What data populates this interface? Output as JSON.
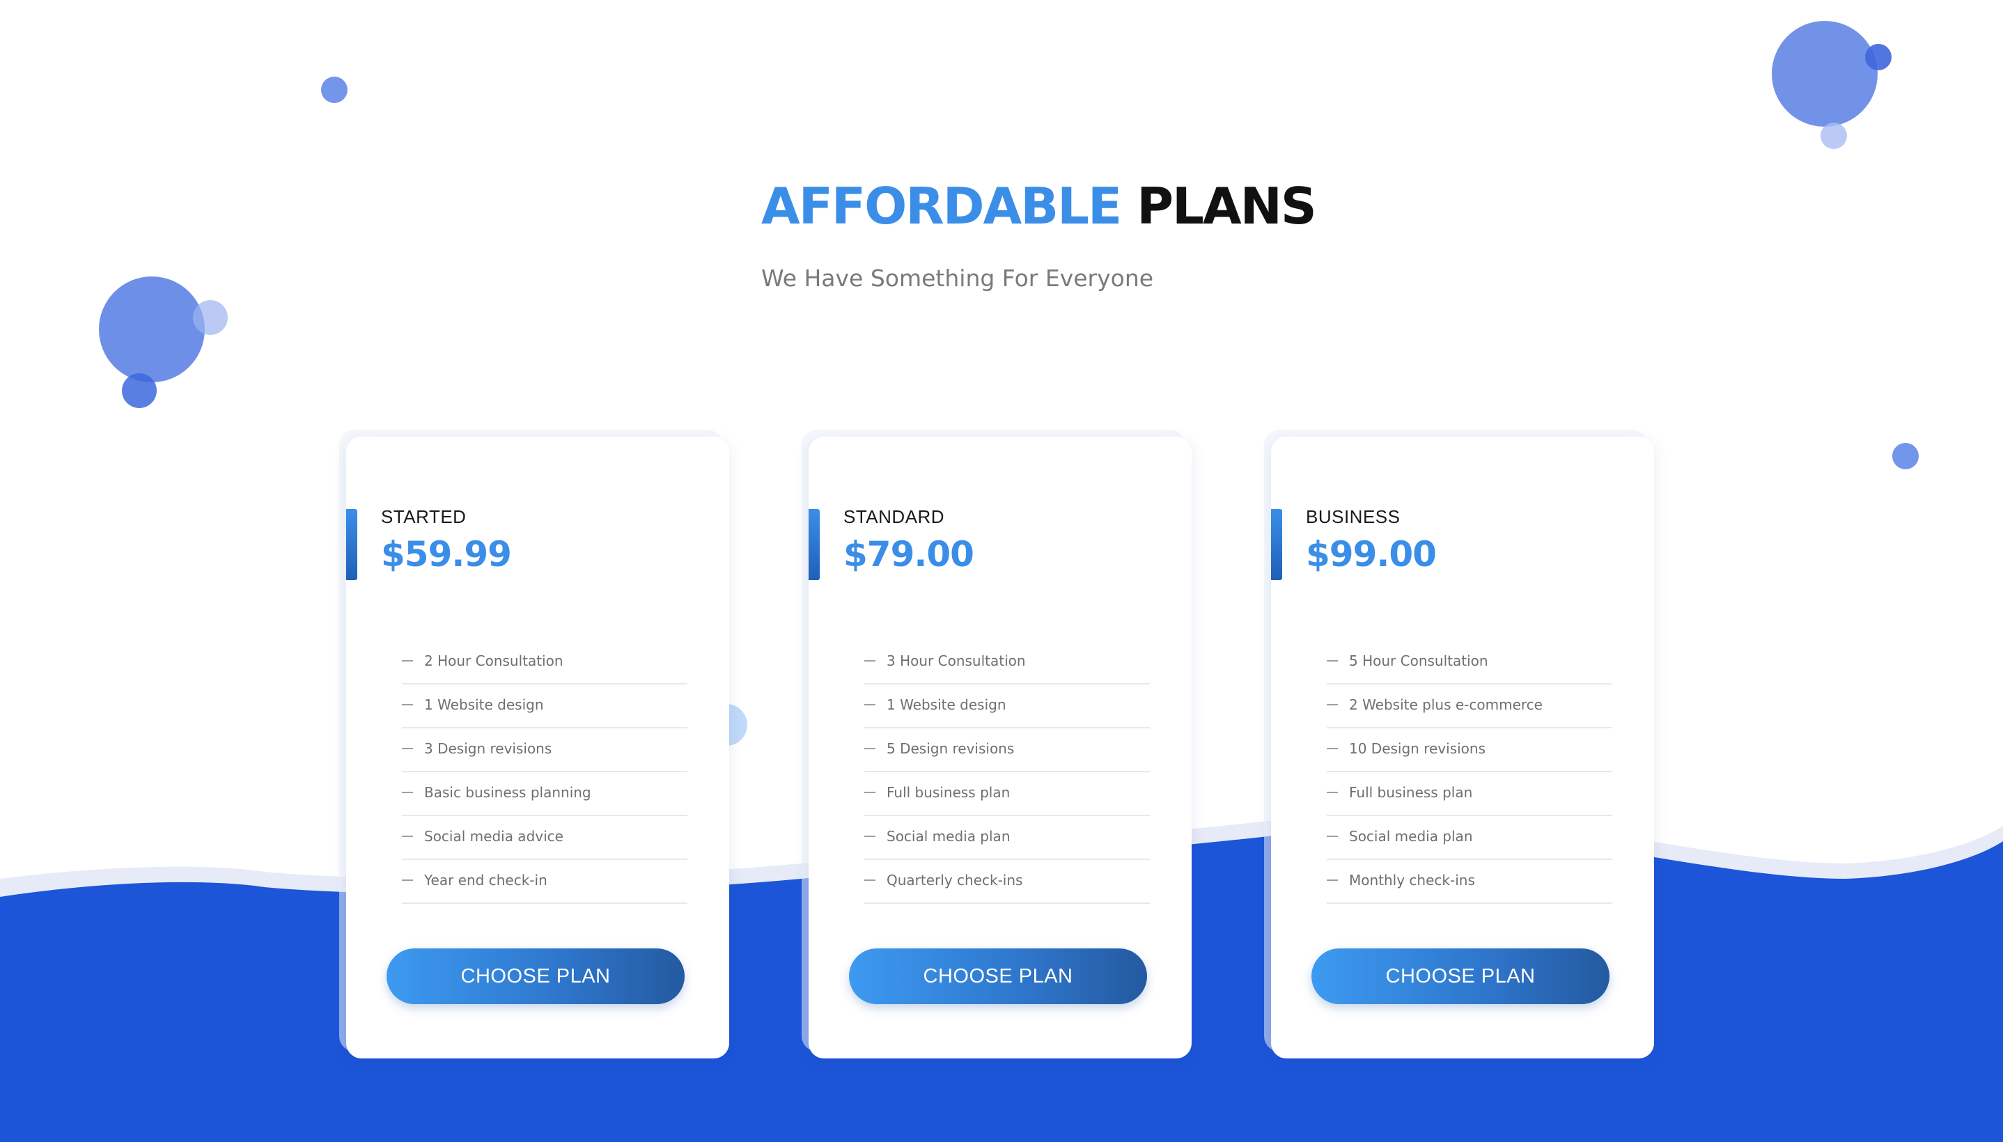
{
  "header": {
    "title_accent": "AFFORDABLE",
    "title_rest": "PLANS",
    "subtitle": "We Have Something For Everyone"
  },
  "colors": {
    "accent": "#3b8ee8",
    "wave_blue": "#1d55d9",
    "button_start": "#3d9af0",
    "button_end": "#245aa0"
  },
  "plans": [
    {
      "name": "STARTED",
      "price": "$59.99",
      "features": [
        "2 Hour Consultation",
        "1 Website design",
        "3 Design revisions",
        "Basic business planning",
        "Social media advice",
        "Year end check-in"
      ],
      "button_label": "CHOOSE PLAN"
    },
    {
      "name": "STANDARD",
      "price": "$79.00",
      "features": [
        "3 Hour Consultation",
        "1 Website design",
        "5 Design revisions",
        "Full business plan",
        "Social media plan",
        "Quarterly check-ins"
      ],
      "button_label": "CHOOSE PLAN"
    },
    {
      "name": "BUSINESS",
      "price": "$99.00",
      "features": [
        "5 Hour Consultation",
        "2 Website plus e-commerce",
        "10 Design revisions",
        "Full business plan",
        "Social media plan",
        "Monthly check-ins"
      ],
      "button_label": "CHOOSE PLAN"
    }
  ]
}
